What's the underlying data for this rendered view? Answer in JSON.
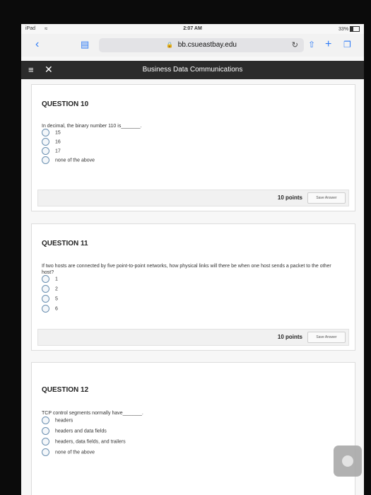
{
  "status_bar": {
    "carrier": "iPad",
    "time": "2:07 AM",
    "battery": "33%"
  },
  "browser": {
    "url": "bb.csueastbay.edu"
  },
  "app": {
    "title": "Business Data Communications"
  },
  "questions": [
    {
      "title": "QUESTION 10",
      "text": "In decimal, the binary number 110 is_______.",
      "options": [
        "15",
        "16",
        "17",
        "none of the above"
      ],
      "points": "10 points",
      "save_label": "Save Answer"
    },
    {
      "title": "QUESTION 11",
      "text": "If two hosts are connected by five point-to-point networks, how physical links will there be when one host sends a packet to the other host?",
      "options": [
        "1",
        "2",
        "5",
        "6"
      ],
      "points": "10 points",
      "save_label": "Save Answer"
    },
    {
      "title": "QUESTION 12",
      "text": "TCP control segments normally have_______.",
      "options": [
        "headers",
        "headers and data fields",
        "headers, data fields, and trailers",
        "none of the above"
      ]
    }
  ]
}
